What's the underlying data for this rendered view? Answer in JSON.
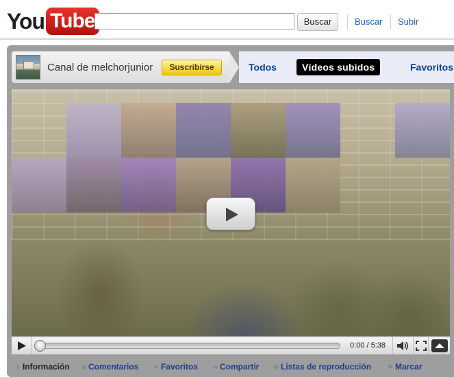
{
  "header": {
    "logo_you": "You",
    "logo_tube": "Tube",
    "search": {
      "value": "",
      "placeholder": ""
    },
    "search_button": "Buscar",
    "links": {
      "buscar": "Buscar",
      "subir": "Subir"
    }
  },
  "channel": {
    "name": "Canal de melchorjunior",
    "subscribe": "Suscribirse",
    "tabs": {
      "todos": "Todos",
      "subidos": "Vídeos subidos",
      "favoritos": "Favoritos"
    },
    "active_tab": "Vídeos subidos"
  },
  "player": {
    "time": "0:00 / 5:38",
    "progress": 0
  },
  "actions": {
    "informacion": "Información",
    "comentarios": "Comentarios",
    "favoritos": "Favoritos",
    "compartir": "Compartir",
    "listas": "Listas de reproducción",
    "marcar": "Marcar"
  },
  "colors": {
    "link_blue": "#1c62b9",
    "tab_blue": "#0b3f8f",
    "subscribe_yellow": "#f0c410",
    "frame_gray": "#9e9e9e"
  }
}
